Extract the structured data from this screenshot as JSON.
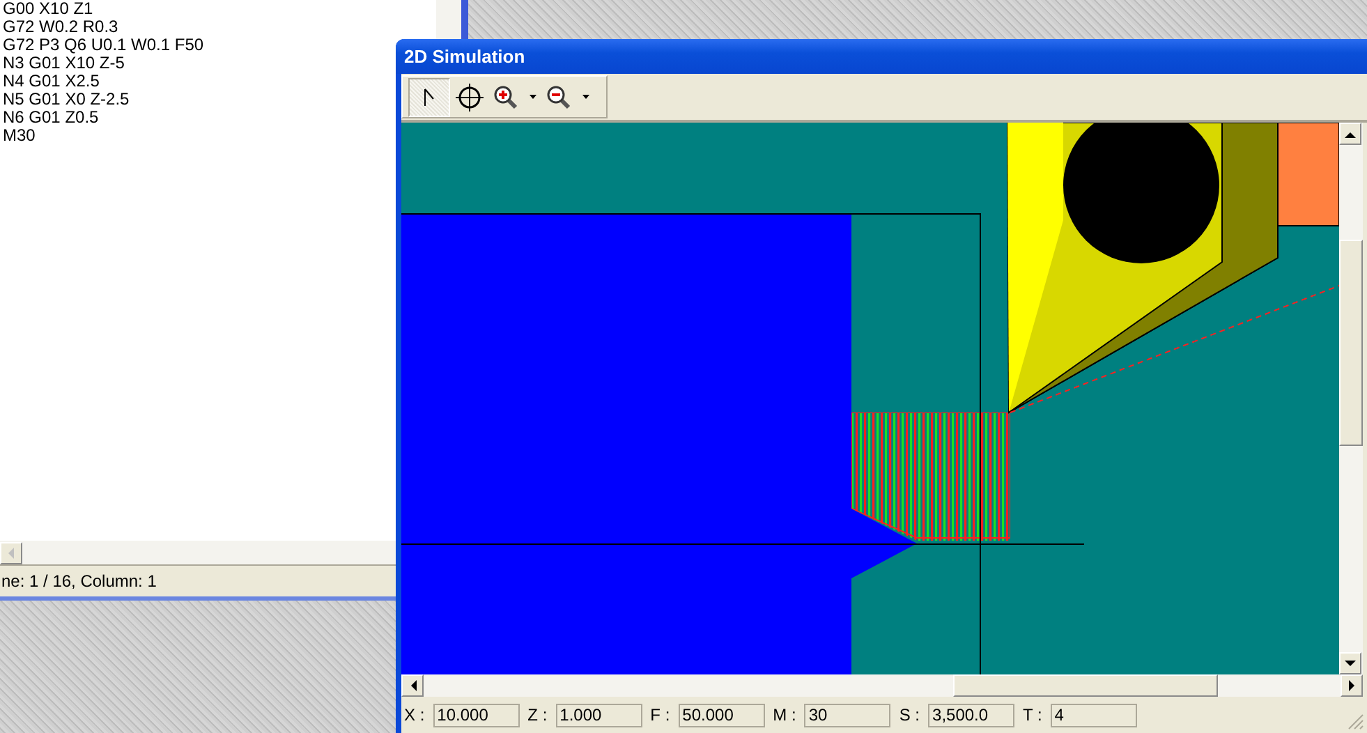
{
  "editor": {
    "lines": [
      "G00 X10 Z1",
      "G72 W0.2 R0.3",
      "G72 P3 Q6 U0.1 W0.1 F50",
      "N3 G01 X10 Z-5",
      "N4 G01 X2.5",
      "N5 G01 X0 Z-2.5",
      "N6 G01 Z0.5",
      "M30"
    ],
    "status": "ne: 1 / 16, Column: 1"
  },
  "simulation": {
    "title": "2D Simulation",
    "toolbar": [
      {
        "kind": "pointer",
        "selected": true,
        "dropdown": false
      },
      {
        "kind": "center",
        "selected": false,
        "dropdown": false
      },
      {
        "kind": "zoom-in",
        "selected": false,
        "dropdown": true
      },
      {
        "kind": "zoom-out",
        "selected": false,
        "dropdown": true
      }
    ],
    "readouts": [
      {
        "label": "X :",
        "value": "10.000"
      },
      {
        "label": "Z :",
        "value": "1.000"
      },
      {
        "label": "F :",
        "value": "50.000"
      },
      {
        "label": "M :",
        "value": "30"
      },
      {
        "label": "S :",
        "value": "3,500.0"
      },
      {
        "label": "T :",
        "value": "4"
      }
    ]
  }
}
